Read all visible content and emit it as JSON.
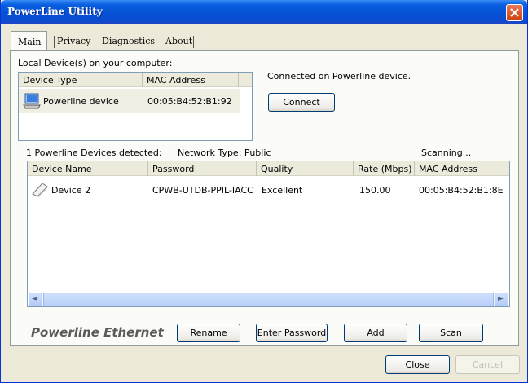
{
  "window": {
    "title": "PowerLine Utility"
  },
  "tabs": [
    {
      "label": "Main",
      "active": true
    },
    {
      "label": "Privacy",
      "active": false
    },
    {
      "label": "Diagnostics",
      "active": false
    },
    {
      "label": "About",
      "active": false
    }
  ],
  "local": {
    "section_label": "Local Device(s) on your computer:",
    "columns": [
      "Device Type",
      "MAC Address"
    ],
    "rows": [
      {
        "type": "Powerline device",
        "mac": "00:05:B4:52:B1:92",
        "icon": "computer-icon"
      }
    ],
    "status": "Connected on Powerline device.",
    "connect_label": "Connect"
  },
  "remote": {
    "detected": "1 Powerline Devices detected:",
    "network_type": "Network Type: Public",
    "scan_status": "Scanning...",
    "columns": [
      "Device Name",
      "Password",
      "Quality",
      "Rate (Mbps)",
      "MAC Address"
    ],
    "rows": [
      {
        "name": "Device 2",
        "password": "CPWB-UTDB-PPIL-IACC",
        "quality": "Excellent",
        "rate": "150.00",
        "mac": "00:05:B4:52:B1:8E",
        "icon": "powerline-adapter-icon"
      }
    ],
    "scroll_left": "◄",
    "scroll_right": "►"
  },
  "footer": {
    "brand": "Powerline Ethernet",
    "rename_label": "Rename",
    "enter_password_label": "Enter Password",
    "add_label": "Add",
    "scan_label": "Scan",
    "close_label": "Close",
    "cancel_label": "Cancel"
  },
  "colors": {
    "title_bar": "#0553d6",
    "close_button": "#d0400e",
    "dialog_bg": "#ece9d8"
  }
}
